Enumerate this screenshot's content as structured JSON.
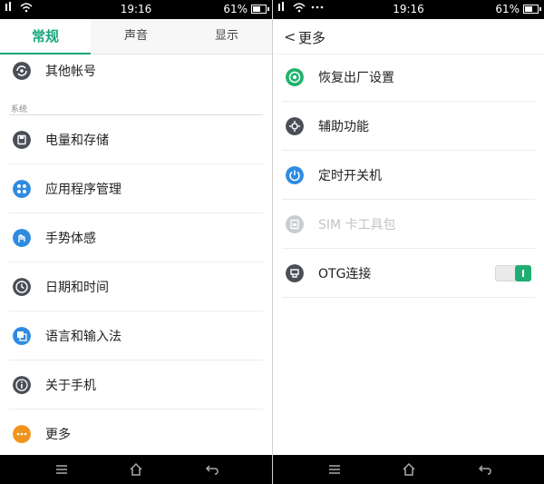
{
  "left": {
    "status": {
      "time": "19:16",
      "battery": "61%"
    },
    "tabs": [
      {
        "label": "常规",
        "active": true
      },
      {
        "label": "声音",
        "active": false
      },
      {
        "label": "显示",
        "active": false
      }
    ],
    "account_item": {
      "label": "其他帐号",
      "icon": "account-sync-icon"
    },
    "section_label": "系统",
    "items": [
      {
        "label": "电量和存储",
        "icon": "storage-icon",
        "color": "#4a4f57"
      },
      {
        "label": "应用程序管理",
        "icon": "apps-icon",
        "color": "#2f8be0"
      },
      {
        "label": "手势体感",
        "icon": "gesture-icon",
        "color": "#2f8be0"
      },
      {
        "label": "日期和时间",
        "icon": "clock-icon",
        "color": "#4a4f57"
      },
      {
        "label": "语言和输入法",
        "icon": "language-icon",
        "color": "#2f8be0"
      },
      {
        "label": "关于手机",
        "icon": "info-icon",
        "color": "#4a4f57"
      },
      {
        "label": "更多",
        "icon": "more-icon",
        "color": "#f0941e"
      }
    ]
  },
  "right": {
    "status": {
      "time": "19:16",
      "battery": "61%"
    },
    "header": {
      "back_glyph": "<",
      "title": "更多"
    },
    "items": [
      {
        "label": "恢复出厂设置",
        "icon": "reset-icon",
        "color": "#20b36b",
        "enabled": true
      },
      {
        "label": "辅助功能",
        "icon": "accessibility-icon",
        "color": "#4a4f57",
        "enabled": true
      },
      {
        "label": "定时开关机",
        "icon": "scheduled-power-icon",
        "color": "#2f8be0",
        "enabled": true
      },
      {
        "label": "SIM 卡工具包",
        "icon": "sim-toolkit-icon",
        "color": "#c9cbce",
        "enabled": false
      },
      {
        "label": "OTG连接",
        "icon": "otg-icon",
        "color": "#4a4f57",
        "enabled": true,
        "toggle": true
      }
    ]
  },
  "colors": {
    "accent": "#18a67e",
    "toggle_on": "#1fae72"
  }
}
